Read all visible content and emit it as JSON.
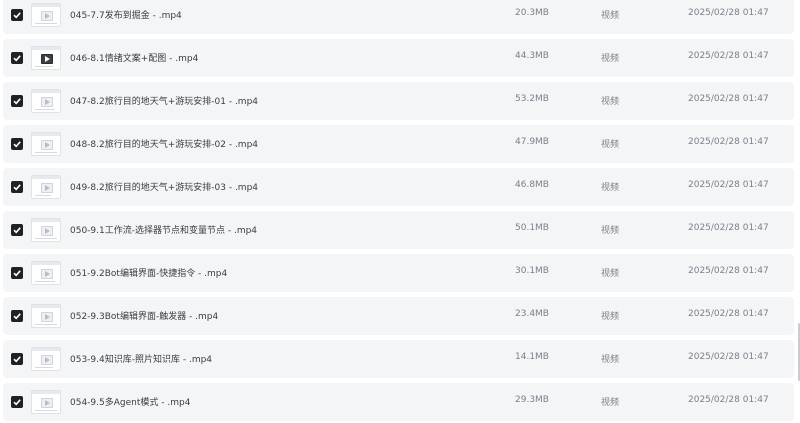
{
  "files": [
    {
      "name": "045-7.7发布到掘金 - .mp4",
      "size": "20.3MB",
      "type": "视频",
      "date": "2025/02/28 01:47",
      "thumb_style": "light"
    },
    {
      "name": "046-8.1情绪文案+配图 - .mp4",
      "size": "44.3MB",
      "type": "视频",
      "date": "2025/02/28 01:47",
      "thumb_style": "dark"
    },
    {
      "name": "047-8.2旅行目的地天气+游玩安排-01 - .mp4",
      "size": "53.2MB",
      "type": "视频",
      "date": "2025/02/28 01:47",
      "thumb_style": "light"
    },
    {
      "name": "048-8.2旅行目的地天气+游玩安排-02 - .mp4",
      "size": "47.9MB",
      "type": "视频",
      "date": "2025/02/28 01:47",
      "thumb_style": "light"
    },
    {
      "name": "049-8.2旅行目的地天气+游玩安排-03 - .mp4",
      "size": "46.8MB",
      "type": "视频",
      "date": "2025/02/28 01:47",
      "thumb_style": "light"
    },
    {
      "name": "050-9.1工作流-选择器节点和变量节点 - .mp4",
      "size": "50.1MB",
      "type": "视频",
      "date": "2025/02/28 01:47",
      "thumb_style": "light"
    },
    {
      "name": "051-9.2Bot编辑界面-快捷指令 - .mp4",
      "size": "30.1MB",
      "type": "视频",
      "date": "2025/02/28 01:47",
      "thumb_style": "light"
    },
    {
      "name": "052-9.3Bot编辑界面-触发器 - .mp4",
      "size": "23.4MB",
      "type": "视频",
      "date": "2025/02/28 01:47",
      "thumb_style": "light"
    },
    {
      "name": "053-9.4知识库-照片知识库 - .mp4",
      "size": "14.1MB",
      "type": "视频",
      "date": "2025/02/28 01:47",
      "thumb_style": "light"
    },
    {
      "name": "054-9.5多Agent模式 - .mp4",
      "size": "29.3MB",
      "type": "视频",
      "date": "2025/02/28 01:47",
      "thumb_style": "light"
    }
  ],
  "checkbox_state": "checked",
  "colors": {
    "row_bg": "#f4f5f7",
    "checkbox": "#1f2125",
    "text": "#3a3d44",
    "muted": "#7b808a"
  }
}
